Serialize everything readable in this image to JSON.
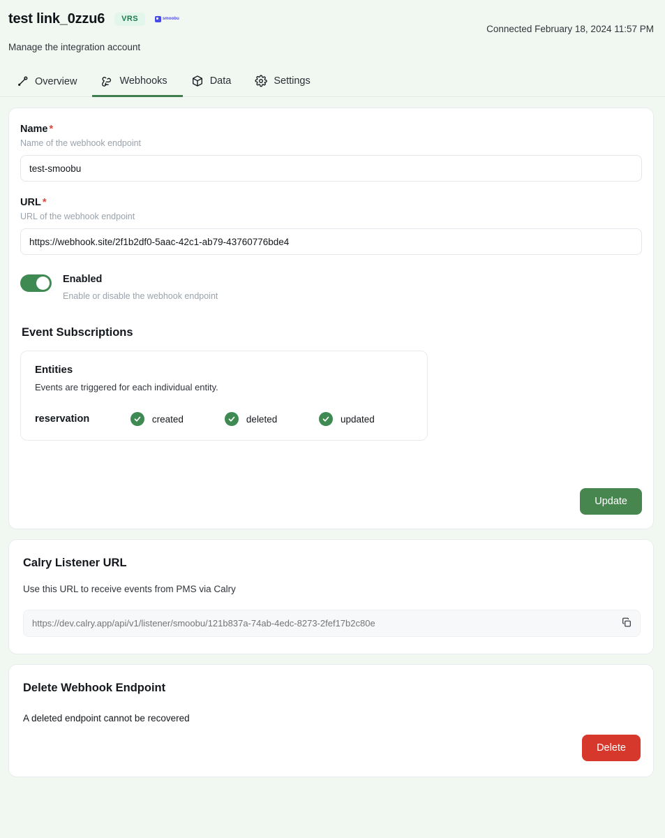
{
  "header": {
    "title": "test link_0zzu6",
    "badge": "VRS",
    "brand_logo": "smoobu",
    "subtitle": "Manage the integration account",
    "connected": "Connected February 18, 2024 11:57 PM"
  },
  "tabs": [
    {
      "label": "Overview",
      "icon": "link-icon",
      "active": false
    },
    {
      "label": "Webhooks",
      "icon": "webhook-icon",
      "active": true
    },
    {
      "label": "Data",
      "icon": "cube-icon",
      "active": false
    },
    {
      "label": "Settings",
      "icon": "gear-icon",
      "active": false
    }
  ],
  "form": {
    "name": {
      "label": "Name",
      "required_mark": "*",
      "hint": "Name of the webhook endpoint",
      "value": "test-smoobu",
      "placeholder": "Name of the webhook endpoint"
    },
    "url": {
      "label": "URL",
      "required_mark": "*",
      "hint": "URL of the webhook endpoint",
      "value": "https://webhook.site/2f1b2df0-5aac-42c1-ab79-43760776bde4",
      "placeholder": "URL of the webhook endpoint"
    },
    "enabled": {
      "label": "Enabled",
      "hint": "Enable or disable the webhook endpoint",
      "state": "on"
    },
    "update_label": "Update"
  },
  "event_subscriptions": {
    "title": "Event Subscriptions",
    "entities": {
      "title": "Entities",
      "hint": "Events are triggered for each individual entity.",
      "rows": [
        {
          "name": "reservation",
          "events": [
            {
              "label": "created",
              "checked": true
            },
            {
              "label": "deleted",
              "checked": true
            },
            {
              "label": "updated",
              "checked": true
            }
          ]
        }
      ]
    }
  },
  "listener": {
    "title": "Calry Listener URL",
    "description": "Use this URL to receive events from PMS via Calry",
    "url": "https://dev.calry.app/api/v1/listener/smoobu/121b837a-74ab-4edc-8273-2fef17b2c80e",
    "copy_icon": "copy-icon"
  },
  "delete_section": {
    "title": "Delete Webhook Endpoint",
    "description": "A deleted endpoint cannot be recovered",
    "button_label": "Delete"
  },
  "colors": {
    "page_background": "#f1f7f1",
    "accent_green": "#47874f",
    "toggle_green": "#3f8a52",
    "danger_red": "#d6392c",
    "badge_background": "#e2f6ec",
    "badge_text": "#1f7a4d",
    "brand_purple": "#4a4ae8"
  }
}
